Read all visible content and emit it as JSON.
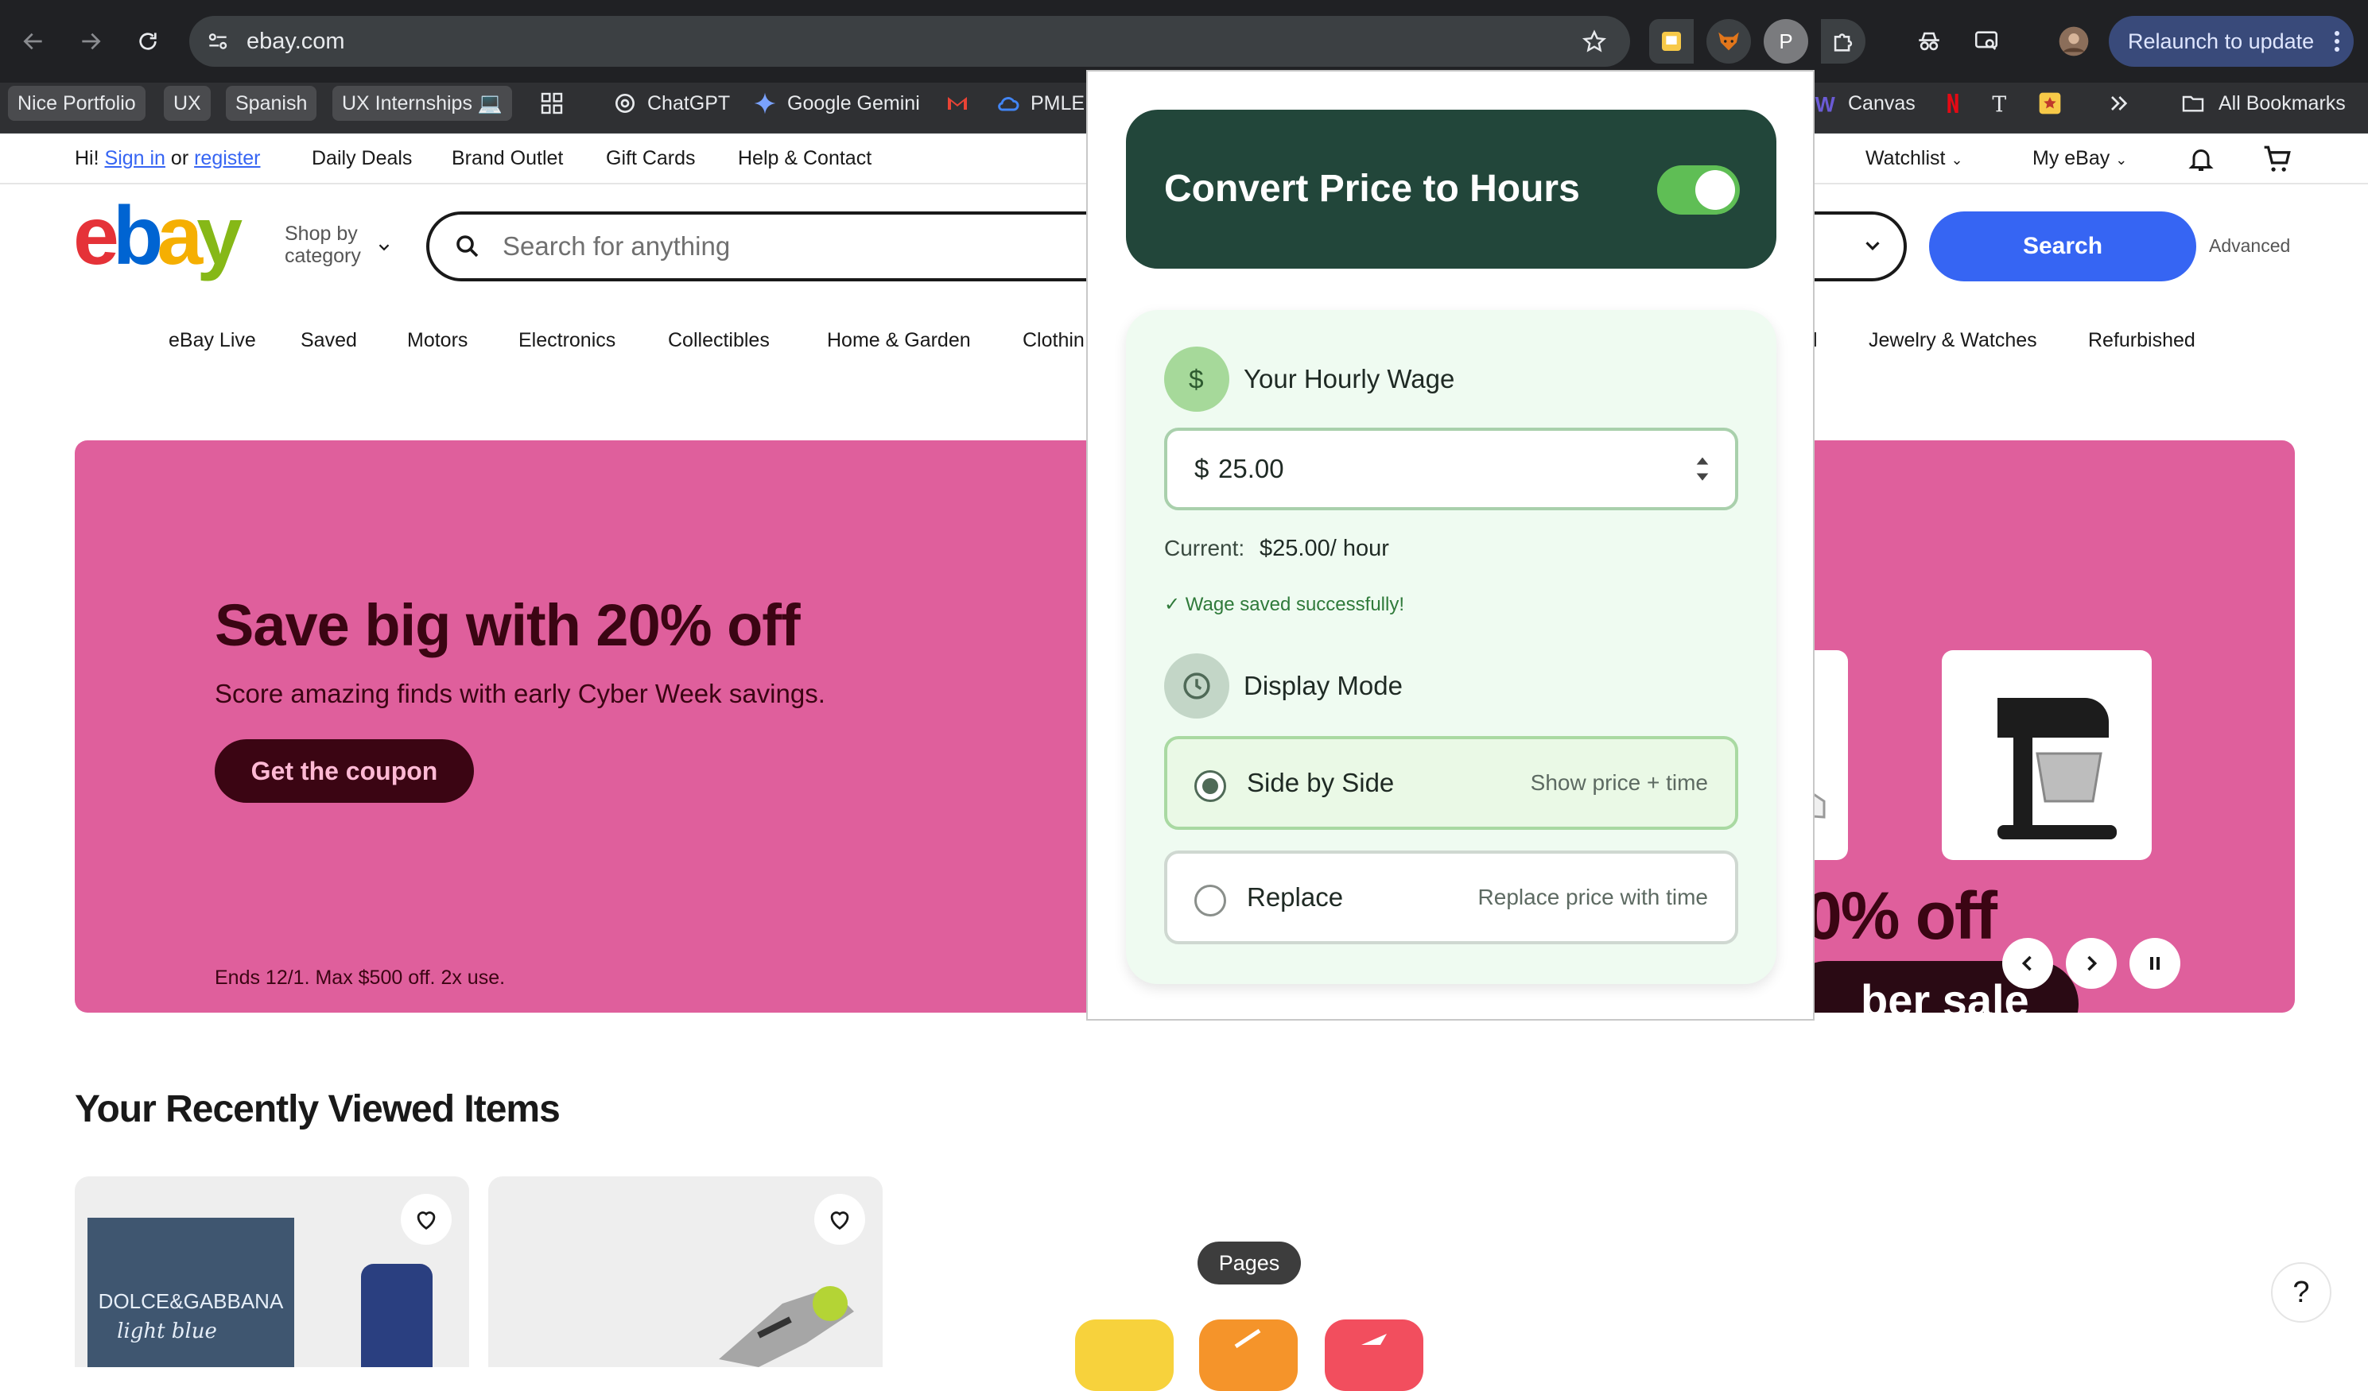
{
  "browser": {
    "url": "ebay.com",
    "relaunch_label": "Relaunch to update",
    "profile_letter": "P",
    "bookmarks": [
      "Nice Portfolio",
      "UX",
      "Spanish",
      "UX Internships 💻",
      "ChatGPT",
      "Google Gemini",
      "PMLE",
      "Canvas"
    ],
    "all_bookmarks_label": "All Bookmarks"
  },
  "ebay": {
    "util": {
      "greeting": "Hi!",
      "sign_in": "Sign in",
      "or": "or",
      "register": "register",
      "links": [
        "Daily Deals",
        "Brand Outlet",
        "Gift Cards",
        "Help & Contact"
      ],
      "watchlist": "Watchlist",
      "my_ebay": "My eBay"
    },
    "shop_by": "Shop by",
    "category": "category",
    "search_placeholder": "Search for anything",
    "search_button": "Search",
    "advanced": "Advanced",
    "categories": [
      "eBay Live",
      "Saved",
      "Motors",
      "Electronics",
      "Collectibles",
      "Home & Garden",
      "Clothin",
      "l",
      "Jewelry & Watches",
      "Refurbished"
    ],
    "hero": {
      "title": "Save big with 20% off",
      "subtitle": "Score amazing finds with early Cyber Week savings.",
      "cta": "Get the coupon",
      "fine_print": "Ends 12/1. Max $500 off. 2x use.",
      "promo_big": "0% off",
      "promo_pill": "ber sale"
    },
    "recently_viewed_title": "Your Recently Viewed Items",
    "product_box_text": [
      "DOLCE&GABBANA",
      "light blue"
    ],
    "help": "?"
  },
  "popup": {
    "title": "Convert Price to Hours",
    "enabled": true,
    "wage_section_title": "Your Hourly Wage",
    "currency_symbol": "$",
    "wage_value": "25.00",
    "current_label": "Current:",
    "current_value": "$25.00/ hour",
    "saved_message": "✓ Wage saved successfully!",
    "display_mode_title": "Display Mode",
    "modes": [
      {
        "label": "Side by Side",
        "desc": "Show price + time",
        "selected": true
      },
      {
        "label": "Replace",
        "desc": "Replace price with time",
        "selected": false
      }
    ]
  },
  "dock": {
    "tooltip": "Pages"
  },
  "colors": {
    "ebay_blue": "#3665f3",
    "hero_pink": "#df5f9c",
    "popup_header": "#22463a",
    "toggle_on": "#5fbe55"
  }
}
